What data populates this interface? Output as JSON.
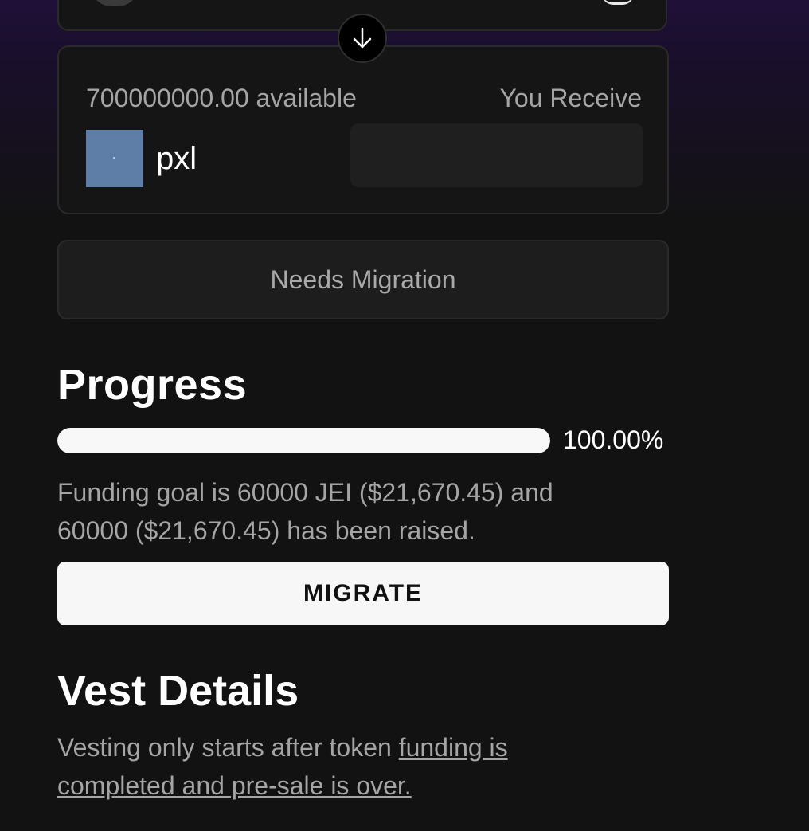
{
  "swap": {
    "available_amount": "700000000.00",
    "available_suffix": "available",
    "receive_label": "You Receive",
    "token_name": "pxl",
    "receive_value": ""
  },
  "status": {
    "label": "Needs Migration"
  },
  "progress": {
    "title": "Progress",
    "percent_text": "100.00%",
    "fraction": 1.0,
    "description": "Funding goal is 60000 JEI ($21,670.45) and 60000 ($21,670.45) has been raised."
  },
  "actions": {
    "migrate_label": "MIGRATE"
  },
  "vest": {
    "title": "Vest Details",
    "text_prefix": "Vesting only starts after token ",
    "link_text": "funding is completed and pre-sale is over."
  },
  "icons": {
    "swap_arrow": "arrow-down-icon",
    "token": "token-image"
  },
  "colors": {
    "background": "#121212",
    "accent_gradient_top": "#1f1038",
    "button": "#f7f7f7",
    "muted_text": "#a5a5a5"
  }
}
